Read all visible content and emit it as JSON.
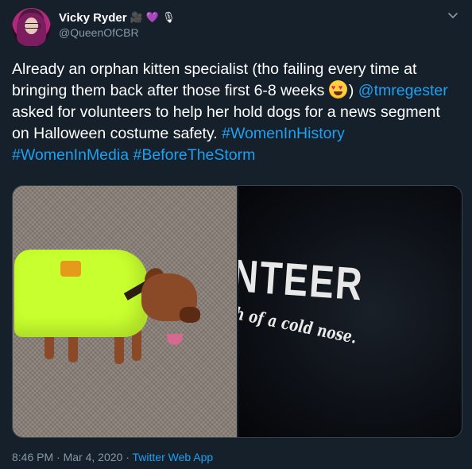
{
  "user": {
    "display_name": "Vicky Ryder",
    "handle": "@QueenOfCBR",
    "name_emojis": [
      "🎥",
      "💜",
      "🎙"
    ]
  },
  "tweet": {
    "text_before_emoji": "Already an orphan kitten specialist (tho failing every time at bringing them back after those first 6-8 weeks ",
    "text_after_emoji_paren": ") ",
    "mention": "@tmregester",
    "text_after_mention": " asked for volunteers to help her hold dogs for a news segment on Halloween costume safety. ",
    "hashtags": [
      "#WomenInHistory",
      "#WomenInMedia",
      "#BeforeTheStorm"
    ]
  },
  "media": {
    "right_photo_text_large": "NTEER",
    "right_photo_text_small": "th of a cold nose."
  },
  "meta": {
    "time": "8:46 PM",
    "separator": " · ",
    "date": "Mar 4, 2020",
    "source": "Twitter Web App"
  },
  "colors": {
    "background": "#15202b",
    "text": "#ffffff",
    "secondary": "#8899a6",
    "link": "#1da1f2"
  },
  "icons": {
    "menu": "chevron-down-icon",
    "emoji": "heart-eyes-emoji-icon"
  }
}
